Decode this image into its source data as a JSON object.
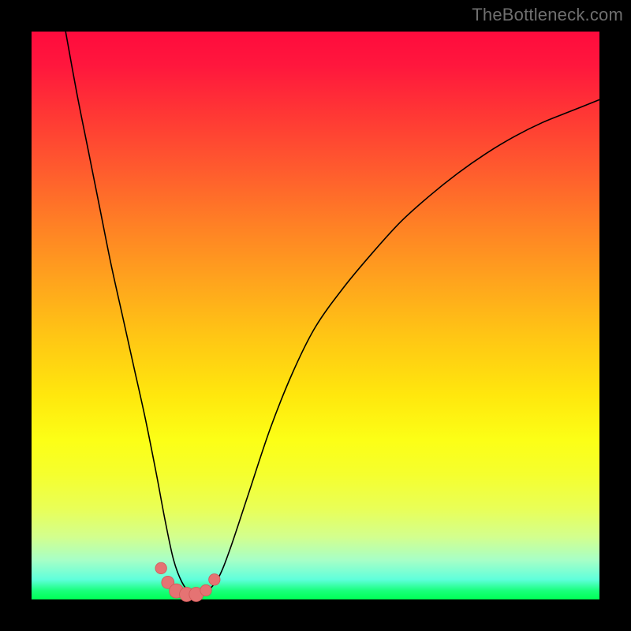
{
  "watermark": "TheBottleneck.com",
  "colors": {
    "frame": "#000000",
    "gradient_top": "#ff0b3d",
    "gradient_bottom": "#00ff55",
    "curve": "#000000",
    "marker_fill": "#e57373",
    "marker_stroke": "#d15a5a"
  },
  "chart_data": {
    "type": "line",
    "title": "",
    "xlabel": "",
    "ylabel": "",
    "xlim": [
      0,
      100
    ],
    "ylim": [
      0,
      100
    ],
    "series": [
      {
        "name": "bottleneck-curve",
        "x": [
          6,
          8,
          10,
          12,
          14,
          16,
          18,
          20,
          22,
          23.5,
          25,
          26.5,
          28,
          29.5,
          31,
          33,
          35,
          38,
          42,
          46,
          50,
          55,
          60,
          65,
          70,
          75,
          80,
          85,
          90,
          95,
          100
        ],
        "y": [
          100,
          89,
          79,
          69,
          59,
          50,
          41,
          32,
          22,
          14,
          7,
          3,
          1.2,
          1.0,
          1.5,
          4,
          9,
          18,
          30,
          40,
          48,
          55,
          61,
          66.5,
          71,
          75,
          78.5,
          81.5,
          84,
          86,
          88
        ]
      }
    ],
    "markers": {
      "name": "highlight-dots",
      "x": [
        23.5,
        25,
        26.5,
        28,
        29.5,
        31
      ],
      "y": [
        14,
        7,
        3,
        1.2,
        1.0,
        1.5,
        4
      ],
      "points": [
        {
          "x": 22.8,
          "y": 5.5,
          "r": 1.0
        },
        {
          "x": 24.0,
          "y": 3.0,
          "r": 1.1
        },
        {
          "x": 25.5,
          "y": 1.5,
          "r": 1.25
        },
        {
          "x": 27.3,
          "y": 0.9,
          "r": 1.25
        },
        {
          "x": 29.0,
          "y": 0.9,
          "r": 1.25
        },
        {
          "x": 30.7,
          "y": 1.6,
          "r": 1.0
        },
        {
          "x": 32.2,
          "y": 3.5,
          "r": 1.0
        }
      ]
    }
  }
}
